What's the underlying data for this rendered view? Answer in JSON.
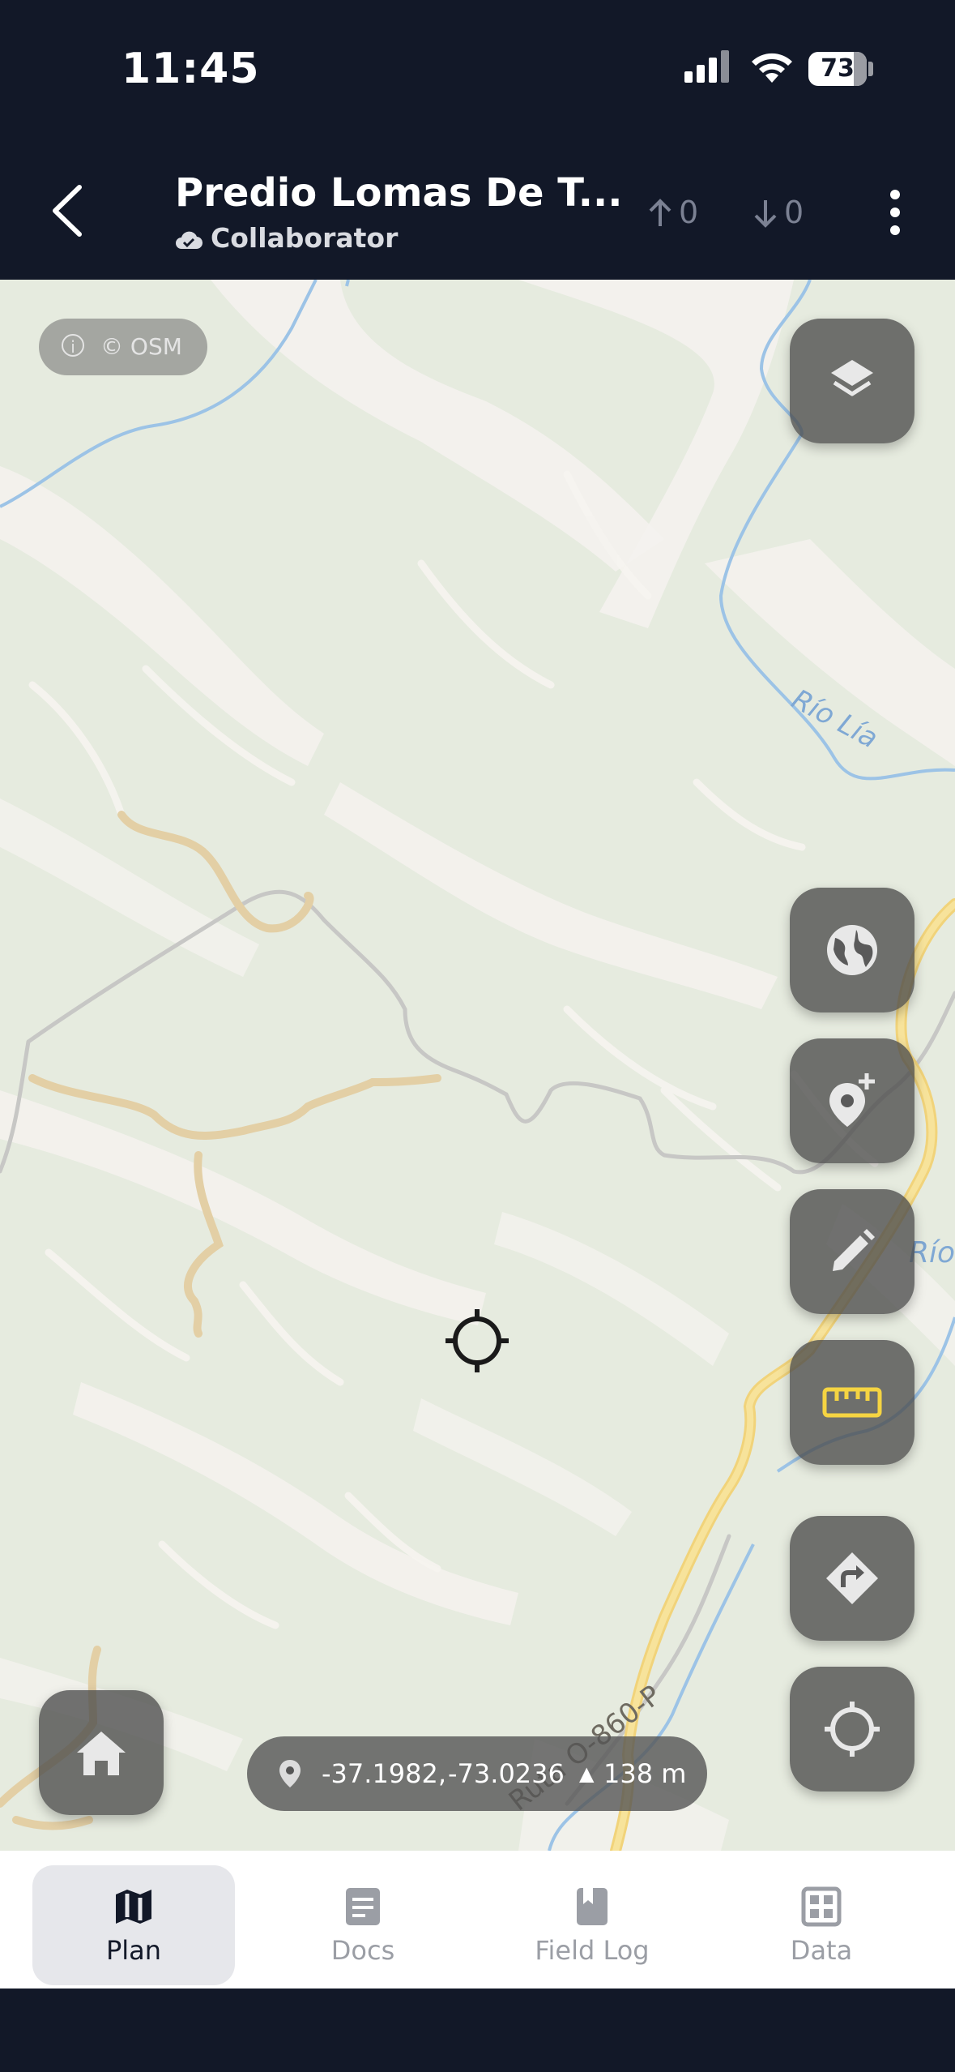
{
  "status_bar": {
    "time": "11:45",
    "battery": "73"
  },
  "header": {
    "title": "Predio Lomas De T...",
    "role": "Collaborator",
    "uploads": "0",
    "downloads": "0"
  },
  "map": {
    "attribution": "© OSM",
    "labels": {
      "river_1": "Río Lía",
      "river_2": "Río",
      "road": "Ruta O-860-P"
    },
    "coordinates": {
      "latitude": "-37.1982,",
      "longitude": "-73.0236",
      "altitude": "138 m"
    }
  },
  "tabs": [
    {
      "label": "Plan",
      "icon": "map-icon",
      "active": true
    },
    {
      "label": "Docs",
      "icon": "document-icon",
      "active": false
    },
    {
      "label": "Field Log",
      "icon": "bookmark-book-icon",
      "active": false
    },
    {
      "label": "Data",
      "icon": "grid-icon",
      "active": false
    }
  ],
  "colors": {
    "dark": "#121828",
    "accent": "#f5d442",
    "map_base": "#e6ebdf"
  }
}
